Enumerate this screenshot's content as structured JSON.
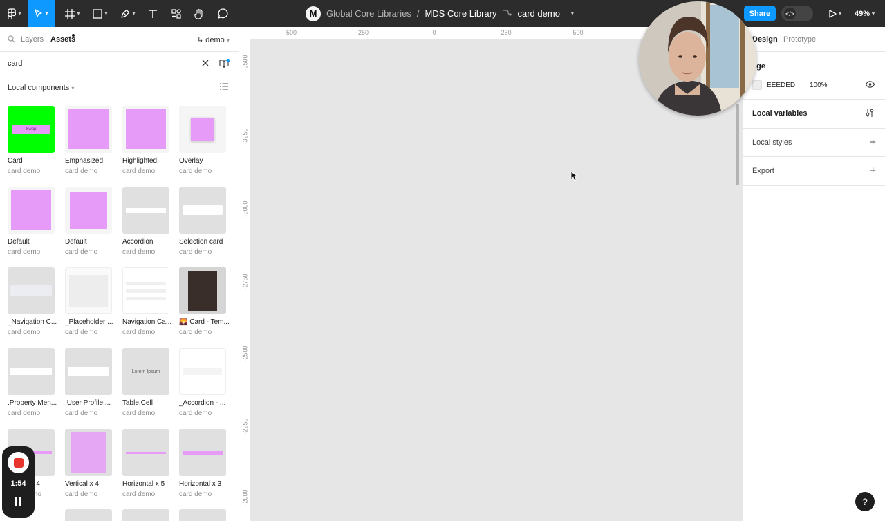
{
  "toolbar": {
    "file_path": {
      "team": "Global Core Libraries",
      "separator": "/",
      "file": "MDS Core Library",
      "branch": "card demo"
    },
    "share_label": "Share",
    "zoom_level": "49%"
  },
  "left_panel": {
    "tabs": {
      "layers": "Layers",
      "assets": "Assets"
    },
    "library_selector": "demo",
    "search_value": "card",
    "filter_label": "Local components",
    "components": [
      {
        "name": "Card",
        "source": "card demo",
        "thumb_label": "Swap"
      },
      {
        "name": "Emphasized",
        "source": "card demo"
      },
      {
        "name": "Highlighted",
        "source": "card demo"
      },
      {
        "name": "Overlay",
        "source": "card demo"
      },
      {
        "name": "Default",
        "source": "card demo"
      },
      {
        "name": "Default",
        "source": "card demo"
      },
      {
        "name": "Accordion",
        "source": "card demo"
      },
      {
        "name": "Selection card",
        "source": "card demo"
      },
      {
        "name": "_Navigation C...",
        "source": "card demo"
      },
      {
        "name": "_Placeholder ...",
        "source": "card demo"
      },
      {
        "name": "Navigation Ca...",
        "source": "card demo"
      },
      {
        "name": "🌄 Card - Tem...",
        "source": "card demo"
      },
      {
        "name": ".Property Men...",
        "source": "card demo"
      },
      {
        "name": ".User Profile ...",
        "source": "card demo"
      },
      {
        "name": "Table.Cell",
        "source": "card demo",
        "thumb_label": "Lorem Ipsum"
      },
      {
        "name": "_Accordion - ...",
        "source": "card demo"
      },
      {
        "name": "al x 4",
        "source": "mo"
      },
      {
        "name": "Vertical x 4",
        "source": "card demo"
      },
      {
        "name": "Horizontal x 5",
        "source": "card demo"
      },
      {
        "name": "Horizontal x 3",
        "source": "card demo"
      }
    ]
  },
  "rulers": {
    "horizontal": [
      "-500",
      "-250",
      "0",
      "250",
      "500"
    ],
    "vertical": [
      "-3500",
      "-3250",
      "-3000",
      "-2750",
      "-2500",
      "-2250",
      "-2000"
    ]
  },
  "right_panel": {
    "tabs": {
      "design": "Design",
      "prototype": "Prototype"
    },
    "page_section": {
      "title": "age",
      "color_hex": "EEEDED",
      "opacity": "100%"
    },
    "local_variables": "Local variables",
    "local_styles": "Local styles",
    "export": "Export"
  },
  "recorder": {
    "elapsed": "1:54"
  },
  "help_label": "?",
  "colors": {
    "toolbar_bg": "#2c2c2c",
    "accent": "#0d99ff",
    "canvas_bg": "#e6e6e6",
    "swatch_green": "#00ff00",
    "swatch_purple": "#e59bf7",
    "page_color": "#EEEDED"
  }
}
